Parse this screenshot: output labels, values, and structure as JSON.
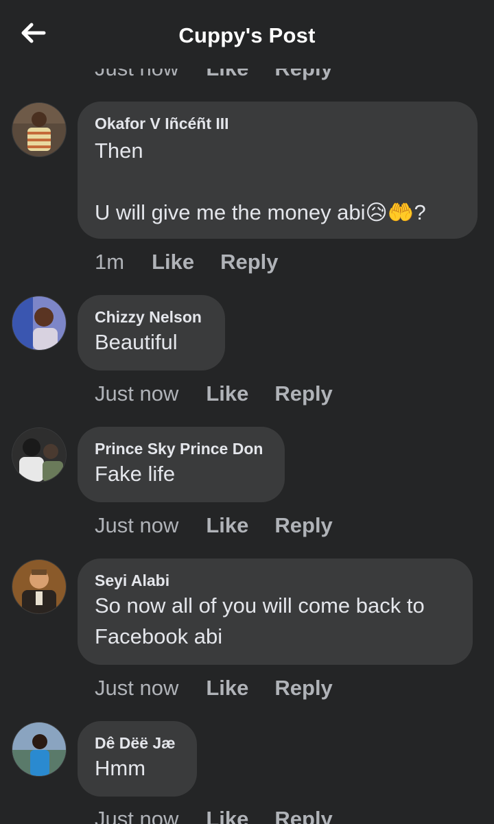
{
  "header": {
    "title": "Cuppy's Post",
    "back_icon": "arrow-left-icon"
  },
  "partial_top_actions": {
    "time": "Just now",
    "like": "Like",
    "reply": "Reply"
  },
  "comments": [
    {
      "author": "Okafor V Iñcéñt III",
      "text": "Then\n\nU will give me the money abi😥🤲?",
      "time": "1m",
      "like": "Like",
      "reply": "Reply"
    },
    {
      "author": "Chizzy Nelson",
      "text": "Beautiful",
      "time": "Just now",
      "like": "Like",
      "reply": "Reply"
    },
    {
      "author": "Prince Sky Prince Don",
      "text": "Fake life",
      "time": "Just now",
      "like": "Like",
      "reply": "Reply"
    },
    {
      "author": "Seyi Alabi",
      "text": "So now all of you will come back to\nFacebook abi",
      "time": "Just now",
      "like": "Like",
      "reply": "Reply"
    },
    {
      "author": "Dê Dëë Jæ",
      "text": "Hmm",
      "time": "Just now",
      "like": "Like",
      "reply": "Reply"
    }
  ],
  "colors": {
    "background": "#242526",
    "bubble": "#3a3b3c",
    "text_primary": "#e4e6eb",
    "text_secondary": "#b0b3b8"
  }
}
